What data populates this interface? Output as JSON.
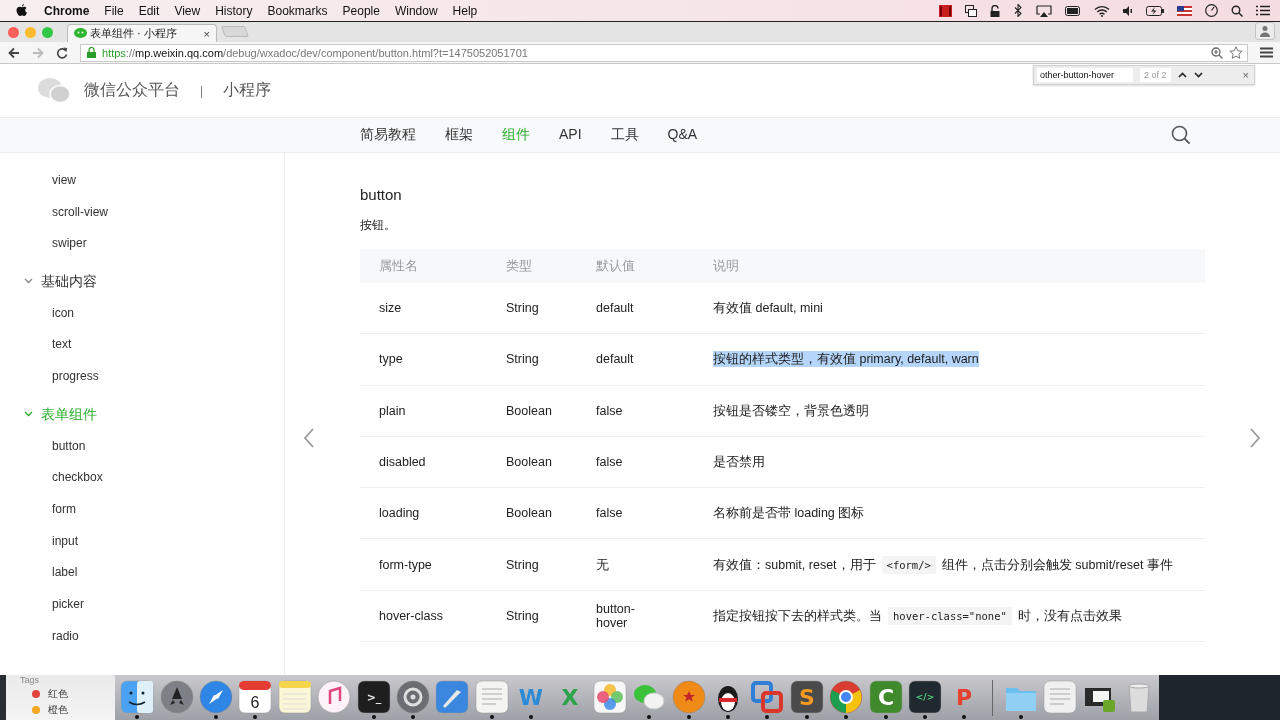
{
  "menubar": {
    "app": "Chrome",
    "menus": [
      "File",
      "Edit",
      "View",
      "History",
      "Bookmarks",
      "People",
      "Window",
      "Help"
    ]
  },
  "browser": {
    "tab": {
      "title": "表单组件 · 小程序",
      "close": "×"
    },
    "url": {
      "scheme": "https",
      "rest": "://",
      "host": "mp.weixin.qq.com",
      "path": "/debug/wxadoc/dev/component/button.html?t=1475052051701"
    },
    "find": {
      "value": "other-button-hover",
      "count": "2 of 2",
      "close": "×"
    }
  },
  "site": {
    "brand": "微信公众平台",
    "divider": "|",
    "product": "小程序"
  },
  "nav": [
    {
      "label": "简易教程",
      "selected": false
    },
    {
      "label": "框架",
      "selected": false
    },
    {
      "label": "组件",
      "selected": true
    },
    {
      "label": "API",
      "selected": false
    },
    {
      "label": "工具",
      "selected": false
    },
    {
      "label": "Q&A",
      "selected": false
    }
  ],
  "sidebar": {
    "items": [
      {
        "label": "view",
        "selected": false
      },
      {
        "label": "scroll-view",
        "selected": false
      },
      {
        "label": "swiper",
        "selected": false
      },
      {
        "label": "基础内容",
        "selected": false,
        "expanded": true,
        "children": [
          {
            "label": "icon",
            "selected": false
          },
          {
            "label": "text",
            "selected": false
          },
          {
            "label": "progress",
            "selected": false
          }
        ]
      },
      {
        "label": "表单组件",
        "selected": true,
        "expanded": true,
        "children": [
          {
            "label": "button",
            "selected": false
          },
          {
            "label": "checkbox",
            "selected": false
          },
          {
            "label": "form",
            "selected": false
          },
          {
            "label": "input",
            "selected": false
          },
          {
            "label": "label",
            "selected": false
          },
          {
            "label": "picker",
            "selected": false
          },
          {
            "label": "radio",
            "selected": false
          }
        ]
      }
    ]
  },
  "content": {
    "title": "button",
    "subtitle": "按钮。",
    "table": {
      "columns": [
        "属性名",
        "类型",
        "默认值",
        "说明"
      ],
      "rows": [
        {
          "cells": [
            "size",
            "String",
            "default"
          ],
          "highlighted": false,
          "description": [
            {
              "kind": "text",
              "text": "有效值 default, mini"
            }
          ]
        },
        {
          "cells": [
            "type",
            "String",
            "default"
          ],
          "highlighted": true,
          "description": [
            {
              "kind": "text",
              "text": "按钮的样式类型，有效值 primary, default, warn"
            }
          ]
        },
        {
          "cells": [
            "plain",
            "Boolean",
            "false"
          ],
          "highlighted": false,
          "description": [
            {
              "kind": "text",
              "text": "按钮是否镂空，背景色透明"
            }
          ]
        },
        {
          "cells": [
            "disabled",
            "Boolean",
            "false"
          ],
          "highlighted": false,
          "description": [
            {
              "kind": "text",
              "text": "是否禁用"
            }
          ]
        },
        {
          "cells": [
            "loading",
            "Boolean",
            "false"
          ],
          "highlighted": false,
          "description": [
            {
              "kind": "text",
              "text": "名称前是否带 loading 图标"
            }
          ]
        },
        {
          "cells": [
            "form-type",
            "String",
            "无"
          ],
          "highlighted": false,
          "description": [
            {
              "kind": "text",
              "text": "有效值：submit, reset，用于"
            },
            {
              "kind": "code",
              "text": "<form/>"
            },
            {
              "kind": "text",
              "text": "组件，点击分别会触发 submit/reset 事件"
            }
          ]
        },
        {
          "cells": [
            "hover-class",
            "String",
            "button-hover"
          ],
          "highlighted": false,
          "description": [
            {
              "kind": "text",
              "text": "指定按钮按下去的样式类。当"
            },
            {
              "kind": "code",
              "text": "hover-class=\"none\""
            },
            {
              "kind": "text",
              "text": "时，没有点击效果"
            }
          ]
        }
      ]
    }
  },
  "finder_tags": {
    "title": "Tags",
    "items": [
      {
        "label": "红色",
        "color": "#e0443e"
      },
      {
        "label": "橙色",
        "color": "#f5a623"
      }
    ]
  },
  "dock": {
    "apps": [
      {
        "kind": "finder",
        "running": true
      },
      {
        "kind": "launchpad",
        "running": false
      },
      {
        "kind": "safari",
        "running": true
      },
      {
        "kind": "calendar",
        "running": true,
        "glyph": "6"
      },
      {
        "kind": "notes",
        "running": false
      },
      {
        "kind": "music",
        "running": false
      },
      {
        "kind": "terminal",
        "running": true,
        "glyph": ">_"
      },
      {
        "kind": "preferences",
        "running": true
      },
      {
        "kind": "xcode",
        "running": false
      },
      {
        "kind": "textedit",
        "running": true
      },
      {
        "kind": "word",
        "running": true,
        "glyph": "W"
      },
      {
        "kind": "excel",
        "running": false,
        "glyph": "X"
      },
      {
        "kind": "photos",
        "running": false
      },
      {
        "kind": "wechat",
        "running": true
      },
      {
        "kind": "ball",
        "running": true
      },
      {
        "kind": "penguin",
        "running": true
      },
      {
        "kind": "parallels",
        "running": true
      },
      {
        "kind": "sublime",
        "running": true,
        "glyph": "S"
      },
      {
        "kind": "chrome",
        "running": true
      },
      {
        "kind": "camtasia",
        "running": true,
        "glyph": "C"
      },
      {
        "kind": "devtools",
        "running": true,
        "glyph": "</>"
      },
      {
        "kind": "wps",
        "running": true,
        "glyph": "P"
      },
      {
        "kind": "separator"
      },
      {
        "kind": "folder",
        "running": true
      },
      {
        "kind": "thumbnail",
        "running": false
      },
      {
        "kind": "window",
        "running": false
      },
      {
        "kind": "trash",
        "running": false
      }
    ]
  }
}
